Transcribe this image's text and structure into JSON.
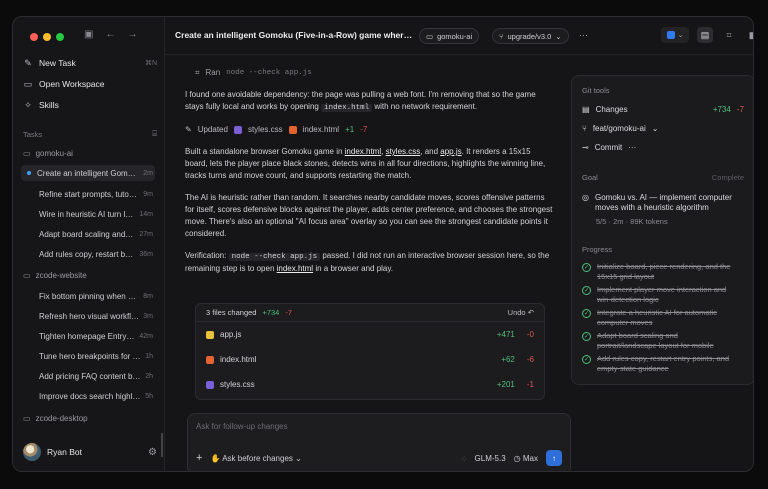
{
  "sidebar": {
    "nav": [
      {
        "label": "New Task",
        "kbd": "⌘N",
        "icon": "pencil-icon"
      },
      {
        "label": "Open Workspace",
        "icon": "folder-icon"
      },
      {
        "label": "Skills",
        "icon": "sparkle-icon"
      }
    ],
    "tasks_label": "Tasks",
    "groups": [
      {
        "name": "gomoku-ai",
        "tasks": [
          {
            "title": "Create an intelligent Gomoku (Five-in-a-Row) game",
            "age": "2m"
          },
          {
            "title": "Refine start prompts, tutorial",
            "age": "9m"
          },
          {
            "title": "Wire in heuristic AI turn logic",
            "age": "14m"
          },
          {
            "title": "Adapt board scaling and layout",
            "age": "27m"
          },
          {
            "title": "Add rules copy, restart button",
            "age": "36m"
          }
        ]
      },
      {
        "name": "zcode-website",
        "tasks": [
          {
            "title": "Fix bottom pinning when scrolling",
            "age": "8m"
          },
          {
            "title": "Refresh hero visual workflow",
            "age": "3m"
          },
          {
            "title": "Tighten homepage Entry copy",
            "age": "42m"
          },
          {
            "title": "Tune hero breakpoints for mobile",
            "age": "1h"
          },
          {
            "title": "Add pricing FAQ content block",
            "age": "2h"
          },
          {
            "title": "Improve docs search highlighting",
            "age": "5h"
          }
        ]
      },
      {
        "name": "zcode-desktop",
        "tasks": []
      }
    ],
    "user": {
      "name": "Ryan Bot"
    }
  },
  "header": {
    "title": "Create an intelligent Gomoku (Five-in-a-Row) game where the AI uses a heuristic algorithm",
    "workspace": "gomoku-ai",
    "branch": "upgrade/v3.0",
    "more": "···"
  },
  "chat": {
    "run_label": "Ran",
    "run_cmd": "node --check app.js",
    "p1_a": "I found one avoidable dependency: the page was pulling a web font. I'm removing that so the game stays fully local and works by opening",
    "p1_code": "index.html",
    "p1_b": "with no network requirement.",
    "updated_label": "Updated",
    "updated_files": [
      "styles.css",
      "index.html"
    ],
    "updated_add": "+1",
    "updated_del": "-7",
    "p2_a": "Built a standalone browser Gomoku game in",
    "p2_f1": "index.html",
    "p2_f2": "styles.css",
    "p2_and": ", and",
    "p2_f3": "app.js",
    "p2_b": ". It renders a 15x15 board, lets the player place black stones, detects wins in all four directions, highlights the winning line, tracks turns and move count, and supports restarting the match.",
    "p3": "The AI is heuristic rather than random. It searches nearby candidate moves, scores offensive patterns for itself, scores defensive blocks against the player, adds center preference, and chooses the strongest move. There's also an optional \"AI focus area\" overlay so you can see the strongest candidate points it considered.",
    "p4_a": "Verification:",
    "p4_code": "node --check app.js",
    "p4_b": "passed. I did not run an interactive browser session here, so the remaining step is to open",
    "p4_link": "index.html",
    "p4_c": "in a browser and play."
  },
  "changes": {
    "summary": "3 files changed",
    "add": "+734",
    "del": "-7",
    "undo": "Undo",
    "files": [
      {
        "name": "app.js",
        "add": "+471",
        "del": "-0",
        "color": "#e8c33a"
      },
      {
        "name": "index.html",
        "add": "+62",
        "del": "-6",
        "color": "#e3642f"
      },
      {
        "name": "styles.css",
        "add": "+201",
        "del": "-1",
        "color": "#7a5fd6"
      }
    ]
  },
  "composer": {
    "placeholder": "Ask for follow-up changes",
    "mode": "Ask before changes",
    "model": "GLM-5.3",
    "effort": "Max"
  },
  "right_panel": {
    "git_label": "Git tools",
    "changes_label": "Changes",
    "changes_add": "+734",
    "changes_del": "-7",
    "branch": "feat/gomoku-ai",
    "commit": "Commit",
    "goal_label": "Goal",
    "goal_status": "Complete",
    "goal_text": "Gomoku vs. AI — implement computer moves with a heuristic algorithm",
    "goal_meta": "5/5 · 2m · 89K tokens",
    "progress_label": "Progress",
    "progress": [
      "Initialize board, piece rendering, and the 15x15 grid layout",
      "Implement player move interaction and win-detection logic",
      "Integrate a heuristic AI for automatic computer moves",
      "Adapt board scaling and portrait/landscape layout for mobile",
      "Add rules copy, restart entry points, and empty-state guidance"
    ]
  }
}
